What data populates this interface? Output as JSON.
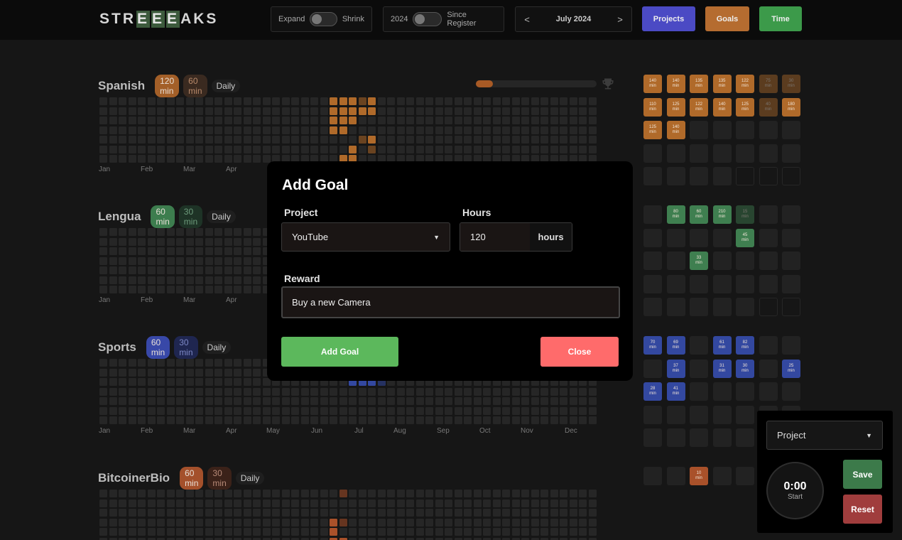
{
  "header": {
    "logo": [
      "S",
      "T",
      "R",
      "E",
      "E",
      "E",
      "A",
      "K",
      "S"
    ],
    "expand_label": "Expand",
    "shrink_label": "Shrink",
    "year_label": "2024",
    "since_label": "Since Register",
    "prev_arrow": "<",
    "month_label": "July 2024",
    "next_arrow": ">",
    "projects_btn": "Projects",
    "goals_btn": "Goals",
    "time_btn": "Time",
    "colors": {
      "projects": "#4b4ac4",
      "goals": "#b56c30",
      "time": "#3c9a4a"
    }
  },
  "sections": [
    {
      "name": "Spanish",
      "goal": "120 min",
      "min": "60 min",
      "freq": "Daily",
      "color": "#b06a2a",
      "pill1_bg": "#a35f28",
      "pill2_bg": "#3a2a20",
      "pill2_fg": "#b8896a"
    },
    {
      "name": "Lengua",
      "goal": "60 min",
      "min": "30 min",
      "freq": "Daily",
      "color": "#3a7a4c",
      "pill1_bg": "#3d7d4e",
      "pill2_bg": "#1e3326",
      "pill2_fg": "#6d9b7b"
    },
    {
      "name": "Sports",
      "goal": "60 min",
      "min": "30 min",
      "freq": "Daily",
      "color": "#3348a0",
      "pill1_bg": "#3848a8",
      "pill2_bg": "#1f2650",
      "pill2_fg": "#7d88c6"
    },
    {
      "name": "BitcoinerBio",
      "goal": "60 min",
      "min": "30 min",
      "freq": "Daily",
      "color": "#a9512a",
      "pill1_bg": "#a4502b",
      "pill2_bg": "#3b2219",
      "pill2_fg": "#b78a78"
    }
  ],
  "month_labels": [
    "Jan",
    "Feb",
    "Mar",
    "Apr",
    "May",
    "Jun",
    "Jul",
    "Aug",
    "Sep",
    "Oct",
    "Nov",
    "Dec"
  ],
  "goal_progress": 0.14,
  "calendars": [
    [
      [
        "140",
        "min"
      ],
      [
        "140",
        "min"
      ],
      [
        "135",
        "min"
      ],
      [
        "135",
        "min"
      ],
      [
        "122",
        "min"
      ],
      [
        "75",
        "min"
      ],
      [
        "30",
        "min"
      ],
      [
        "110",
        "min"
      ],
      [
        "125",
        "min"
      ],
      [
        "122",
        "min"
      ],
      [
        "140",
        "min"
      ],
      [
        "125",
        "min"
      ],
      [
        "40",
        "min"
      ],
      [
        "180",
        "min"
      ],
      [
        "125",
        "min"
      ],
      [
        "140",
        "min"
      ]
    ],
    [
      [
        "",
        ""
      ],
      [
        "80",
        "min"
      ],
      [
        "60",
        "min"
      ],
      [
        "210",
        "min"
      ],
      [
        "15",
        "min"
      ],
      [
        "",
        ""
      ],
      [
        "",
        ""
      ],
      [
        "",
        ""
      ],
      [
        "",
        ""
      ],
      [
        "",
        ""
      ],
      [
        "",
        ""
      ],
      [
        "45",
        "min"
      ],
      [
        "",
        ""
      ],
      [
        "",
        ""
      ],
      [
        "",
        ""
      ],
      [
        "",
        ""
      ],
      [
        "33",
        "min"
      ]
    ],
    [
      [
        "70",
        "min"
      ],
      [
        "69",
        "min"
      ],
      [
        "",
        ""
      ],
      [
        "61",
        "min"
      ],
      [
        "82",
        "min"
      ],
      [
        "",
        ""
      ],
      [
        "",
        ""
      ],
      [
        "",
        ""
      ],
      [
        "37",
        "min"
      ],
      [
        "",
        ""
      ],
      [
        "31",
        "min"
      ],
      [
        "30",
        "min"
      ],
      [
        "",
        ""
      ],
      [
        "25",
        "min"
      ],
      [
        "28",
        "min"
      ],
      [
        "41",
        "min"
      ]
    ],
    [
      [
        "",
        ""
      ],
      [
        "",
        ""
      ],
      [
        "10",
        "min"
      ]
    ]
  ],
  "modal": {
    "title": "Add Goal",
    "project_label": "Project",
    "project_value": "YouTube",
    "hours_label": "Hours",
    "hours_value": "120",
    "hours_suffix": "hours",
    "reward_label": "Reward",
    "reward_value": "Buy a new Camera",
    "add_btn": "Add Goal",
    "close_btn": "Close",
    "colors": {
      "add": "#5cb85c",
      "close": "#ff6b6b"
    }
  },
  "timer": {
    "project_placeholder": "Project",
    "time": "0:00",
    "start_label": "Start",
    "save_btn": "Save",
    "reset_btn": "Reset",
    "colors": {
      "save": "#3c7a4a",
      "reset": "#a03d3d"
    }
  }
}
